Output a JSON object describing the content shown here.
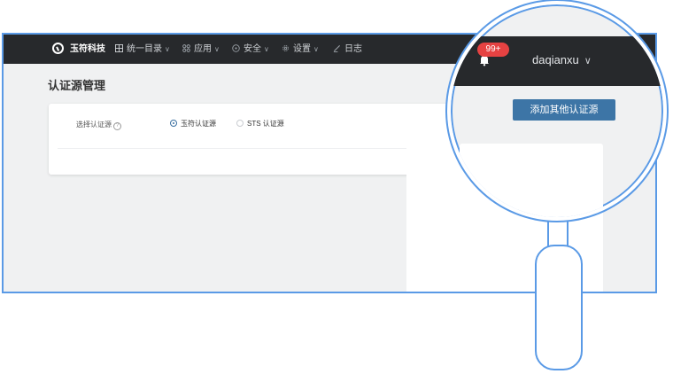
{
  "brand": {
    "name": "玉符科技"
  },
  "nav": {
    "items": [
      {
        "label": "统一目录",
        "icon": "directory-icon",
        "has_menu": true
      },
      {
        "label": "应用",
        "icon": "apps-grid-icon",
        "has_menu": true
      },
      {
        "label": "安全",
        "icon": "shield-icon",
        "has_menu": true
      },
      {
        "label": "设置",
        "icon": "gear-icon",
        "has_menu": true
      },
      {
        "label": "日志",
        "icon": "log-pen-icon",
        "has_menu": false
      }
    ]
  },
  "user": {
    "name": "daqianxu",
    "notifications_badge": "99+"
  },
  "page": {
    "title": "认证源管理",
    "add_button_label": "添加其他认证源",
    "source_selector": {
      "label": "选择认证源",
      "options": [
        {
          "label": "玉符认证源",
          "checked": true
        },
        {
          "label": "STS 认证源",
          "checked": false
        }
      ]
    }
  },
  "colors": {
    "topbar": "#27292c",
    "accent": "#3d75a6",
    "badge": "#e64242",
    "frame_outline": "#5a9ae6"
  }
}
